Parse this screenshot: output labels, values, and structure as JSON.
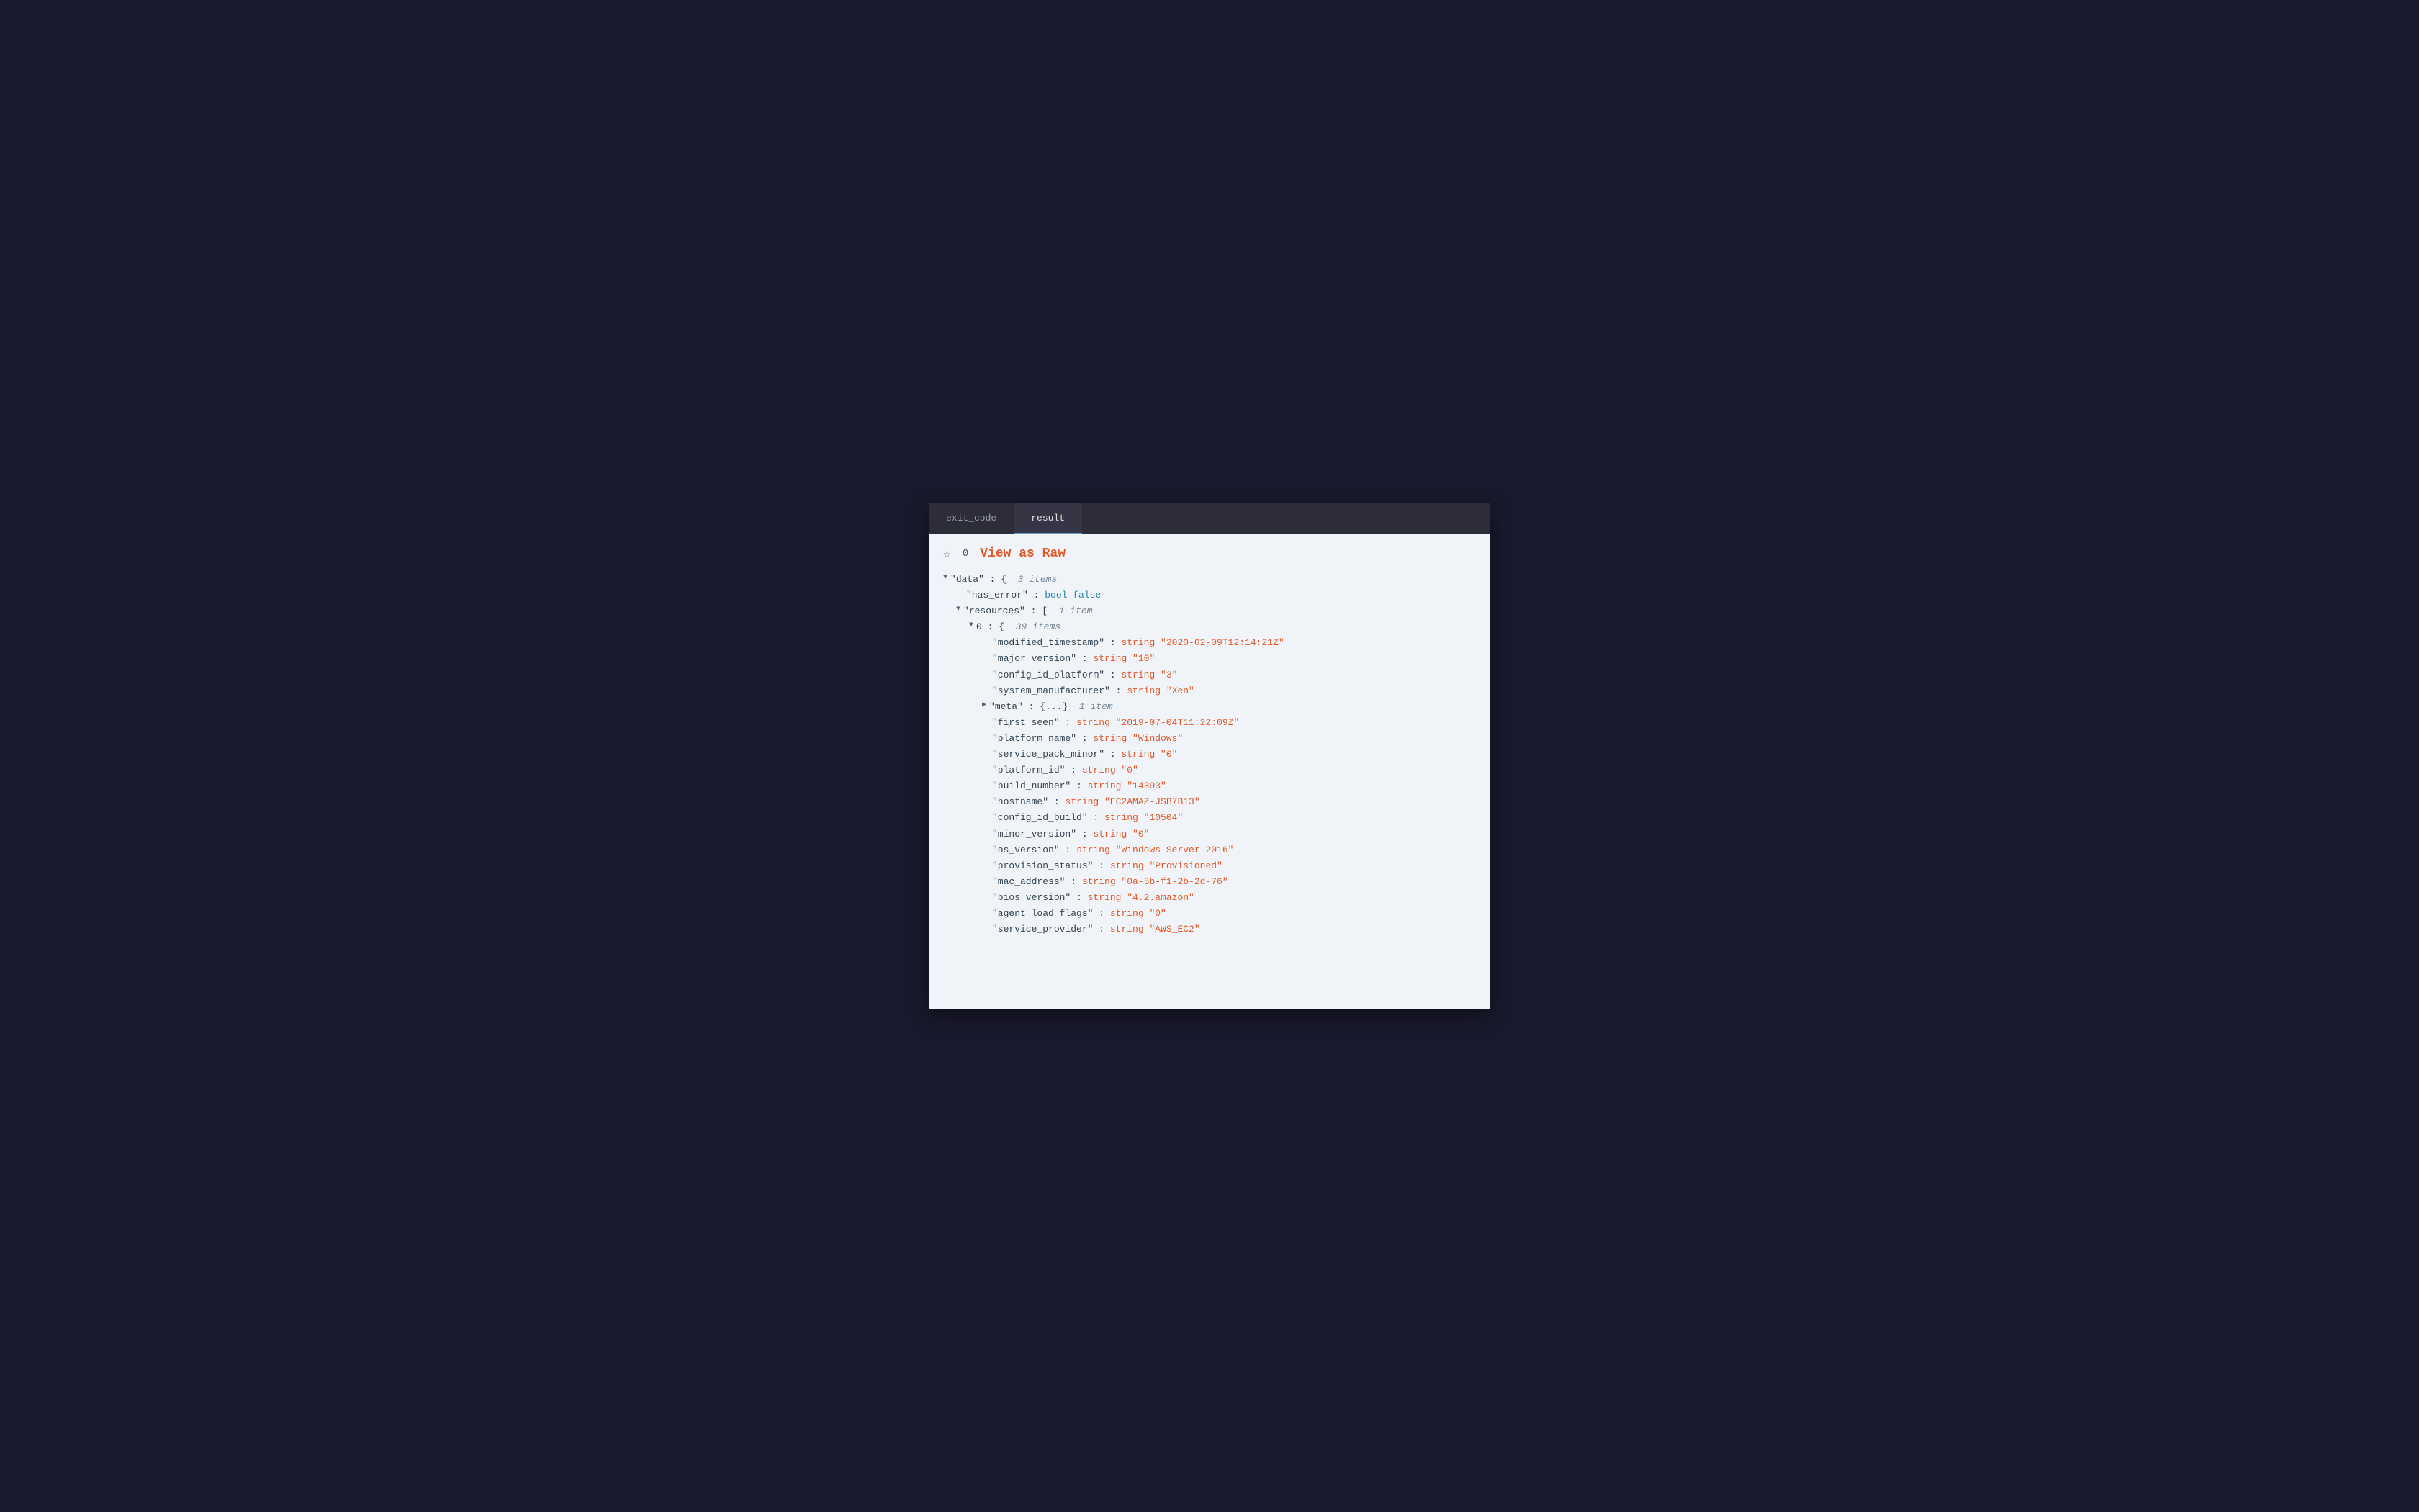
{
  "tabs": [
    {
      "id": "exit_code",
      "label": "exit_code",
      "active": false
    },
    {
      "id": "result",
      "label": "result",
      "active": true
    }
  ],
  "exit_code_value": "0",
  "view_raw_label": "View as Raw",
  "json_lines": [
    {
      "indent": 0,
      "arrow": "down",
      "content": [
        {
          "type": "key",
          "text": "\"data\""
        },
        {
          "type": "colon",
          "text": " : "
        },
        {
          "type": "bracket",
          "text": "{"
        },
        {
          "type": "meta",
          "text": "  3 items"
        }
      ]
    },
    {
      "indent": 1,
      "arrow": null,
      "content": [
        {
          "type": "key",
          "text": "\"has_error\""
        },
        {
          "type": "colon",
          "text": " : "
        },
        {
          "type": "bool",
          "text": "bool false"
        }
      ]
    },
    {
      "indent": 1,
      "arrow": "down",
      "content": [
        {
          "type": "key",
          "text": "\"resources\""
        },
        {
          "type": "colon",
          "text": " : "
        },
        {
          "type": "bracket",
          "text": "["
        },
        {
          "type": "meta",
          "text": "  1 item"
        }
      ]
    },
    {
      "indent": 2,
      "arrow": "down",
      "content": [
        {
          "type": "key",
          "text": "0 : "
        },
        {
          "type": "bracket",
          "text": "{"
        },
        {
          "type": "meta",
          "text": "  39 items"
        }
      ]
    },
    {
      "indent": 3,
      "arrow": null,
      "content": [
        {
          "type": "key",
          "text": "\"modified_timestamp\""
        },
        {
          "type": "colon",
          "text": " : "
        },
        {
          "type": "string",
          "text": "string \"2020-02-09T12:14:21Z\""
        }
      ]
    },
    {
      "indent": 3,
      "arrow": null,
      "content": [
        {
          "type": "key",
          "text": "\"major_version\""
        },
        {
          "type": "colon",
          "text": " : "
        },
        {
          "type": "string",
          "text": "string \"10\""
        }
      ]
    },
    {
      "indent": 3,
      "arrow": null,
      "content": [
        {
          "type": "key",
          "text": "\"config_id_platform\""
        },
        {
          "type": "colon",
          "text": " : "
        },
        {
          "type": "string",
          "text": "string \"3\""
        }
      ]
    },
    {
      "indent": 3,
      "arrow": null,
      "content": [
        {
          "type": "key",
          "text": "\"system_manufacturer\""
        },
        {
          "type": "colon",
          "text": " : "
        },
        {
          "type": "string",
          "text": "string \"Xen\""
        }
      ]
    },
    {
      "indent": 3,
      "arrow": "right",
      "content": [
        {
          "type": "key",
          "text": "\"meta\""
        },
        {
          "type": "colon",
          "text": " : "
        },
        {
          "type": "bracket",
          "text": "{...}"
        },
        {
          "type": "meta",
          "text": "  1 item"
        }
      ]
    },
    {
      "indent": 3,
      "arrow": null,
      "content": [
        {
          "type": "key",
          "text": "\"first_seen\""
        },
        {
          "type": "colon",
          "text": " : "
        },
        {
          "type": "string",
          "text": "string \"2019-07-04T11:22:09Z\""
        }
      ]
    },
    {
      "indent": 3,
      "arrow": null,
      "content": [
        {
          "type": "key",
          "text": "\"platform_name\""
        },
        {
          "type": "colon",
          "text": " : "
        },
        {
          "type": "string",
          "text": "string \"Windows\""
        }
      ]
    },
    {
      "indent": 3,
      "arrow": null,
      "content": [
        {
          "type": "key",
          "text": "\"service_pack_minor\""
        },
        {
          "type": "colon",
          "text": " : "
        },
        {
          "type": "string",
          "text": "string \"0\""
        }
      ]
    },
    {
      "indent": 3,
      "arrow": null,
      "content": [
        {
          "type": "key",
          "text": "\"platform_id\""
        },
        {
          "type": "colon",
          "text": " : "
        },
        {
          "type": "string",
          "text": "string \"0\""
        }
      ]
    },
    {
      "indent": 3,
      "arrow": null,
      "content": [
        {
          "type": "key",
          "text": "\"build_number\""
        },
        {
          "type": "colon",
          "text": " : "
        },
        {
          "type": "string",
          "text": "string \"14393\""
        }
      ]
    },
    {
      "indent": 3,
      "arrow": null,
      "content": [
        {
          "type": "key",
          "text": "\"hostname\""
        },
        {
          "type": "colon",
          "text": " : "
        },
        {
          "type": "string",
          "text": "string \"EC2AMAZ-JSB7B13\""
        }
      ]
    },
    {
      "indent": 3,
      "arrow": null,
      "content": [
        {
          "type": "key",
          "text": "\"config_id_build\""
        },
        {
          "type": "colon",
          "text": " : "
        },
        {
          "type": "string",
          "text": "string \"10504\""
        }
      ]
    },
    {
      "indent": 3,
      "arrow": null,
      "content": [
        {
          "type": "key",
          "text": "\"minor_version\""
        },
        {
          "type": "colon",
          "text": " : "
        },
        {
          "type": "string",
          "text": "string \"0\""
        }
      ]
    },
    {
      "indent": 3,
      "arrow": null,
      "content": [
        {
          "type": "key",
          "text": "\"os_version\""
        },
        {
          "type": "colon",
          "text": " : "
        },
        {
          "type": "string",
          "text": "string \"Windows Server 2016\""
        }
      ]
    },
    {
      "indent": 3,
      "arrow": null,
      "content": [
        {
          "type": "key",
          "text": "\"provision_status\""
        },
        {
          "type": "colon",
          "text": " : "
        },
        {
          "type": "string",
          "text": "string \"Provisioned\""
        }
      ]
    },
    {
      "indent": 3,
      "arrow": null,
      "content": [
        {
          "type": "key",
          "text": "\"mac_address\""
        },
        {
          "type": "colon",
          "text": " : "
        },
        {
          "type": "string",
          "text": "string \"0a-5b-f1-2b-2d-76\""
        }
      ]
    },
    {
      "indent": 3,
      "arrow": null,
      "content": [
        {
          "type": "key",
          "text": "\"bios_version\""
        },
        {
          "type": "colon",
          "text": " : "
        },
        {
          "type": "string",
          "text": "string \"4.2.amazon\""
        }
      ]
    },
    {
      "indent": 3,
      "arrow": null,
      "content": [
        {
          "type": "key",
          "text": "\"agent_load_flags\""
        },
        {
          "type": "colon",
          "text": " : "
        },
        {
          "type": "string",
          "text": "string \"0\""
        }
      ]
    },
    {
      "indent": 3,
      "arrow": null,
      "content": [
        {
          "type": "key",
          "text": "\"service_provider\""
        },
        {
          "type": "colon",
          "text": " : "
        },
        {
          "type": "string",
          "text": "string \"AWS_EC2\""
        }
      ]
    }
  ]
}
